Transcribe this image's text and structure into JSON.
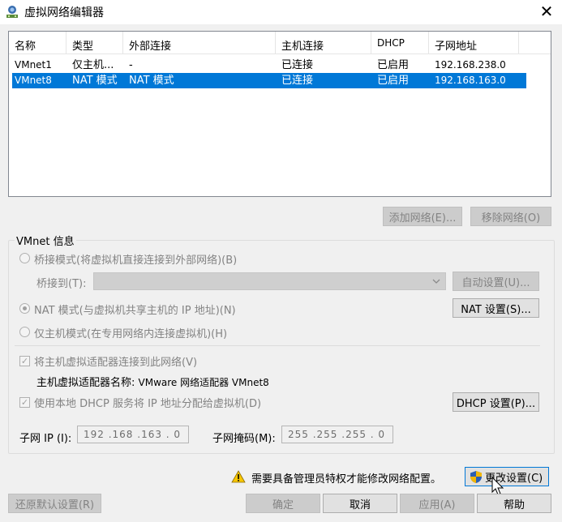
{
  "window": {
    "title": "虚拟网络编辑器",
    "close_glyph": "✕"
  },
  "table": {
    "headers": [
      "名称",
      "类型",
      "外部连接",
      "主机连接",
      "DHCP",
      "子网地址"
    ],
    "rows": [
      [
        "VMnet1",
        "仅主机...",
        "-",
        "已连接",
        "已启用",
        "192.168.238.0"
      ],
      [
        "VMnet8",
        "NAT 模式",
        "NAT 模式",
        "已连接",
        "已启用",
        "192.168.163.0"
      ]
    ],
    "selected_index": 1
  },
  "buttons": {
    "add_network": "添加网络(E)...",
    "remove_network": "移除网络(O)",
    "auto_settings": "自动设置(U)...",
    "nat_settings": "NAT 设置(S)...",
    "dhcp_settings": "DHCP 设置(P)...",
    "change_settings": "更改设置(C)",
    "restore_defaults": "还原默认设置(R)",
    "ok": "确定",
    "cancel": "取消",
    "apply": "应用(A)",
    "help": "帮助"
  },
  "info": {
    "group_label": "VMnet 信息",
    "bridged_mode": "桥接模式(将虚拟机直接连接到外部网络)(B)",
    "bridged_to_label": "桥接到(T):",
    "nat_mode": "NAT 模式(与虚拟机共享主机的 IP 地址)(N)",
    "host_only_mode": "仅主机模式(在专用网络内连接虚拟机)(H)",
    "connect_adapter": "将主机虚拟适配器连接到此网络(V)",
    "adapter_name_label": "主机虚拟适配器名称: ",
    "adapter_name_value": "VMware 网络适配器 VMnet8",
    "use_dhcp": "使用本地 DHCP 服务将 IP 地址分配给虚拟机(D)",
    "subnet_ip_label": "子网 IP (I):",
    "subnet_ip_value": "192 .168 .163 . 0",
    "subnet_mask_label": "子网掩码(M):",
    "subnet_mask_value": "255 .255 .255 . 0",
    "selected_mode": "nat"
  },
  "admin_warning": "需要具备管理员特权才能修改网络配置。",
  "icons": {
    "warning": "warning-icon",
    "shield": "shield-icon",
    "app": "network-editor-icon"
  }
}
